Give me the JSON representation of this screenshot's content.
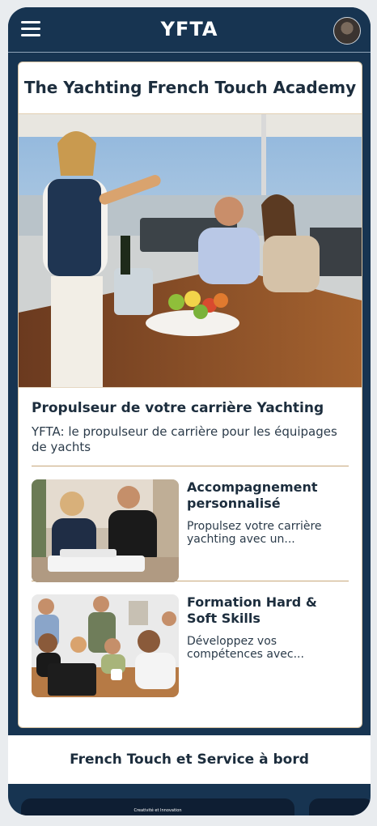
{
  "header": {
    "logo": "YFTA"
  },
  "card": {
    "title": "The Yachting French Touch Academy",
    "hero": {
      "title": "Propulseur de votre carrière Yachting",
      "subtitle": "YFTA: le propulseur de carrière pour les équipages de yachts"
    },
    "items": [
      {
        "title": "Accompagnement personnalisé",
        "subtitle": "Propulsez votre carrière yachting avec un..."
      },
      {
        "title": "Formation Hard & Soft Skills",
        "subtitle": "Développez vos compétences avec..."
      }
    ]
  },
  "section2": {
    "title": "French Touch et Service à bord"
  },
  "carousel": {
    "card1_label": "Creativité et Innovation"
  },
  "colors": {
    "navy": "#173451",
    "gold": "#c7a77a",
    "white": "#ffffff"
  }
}
